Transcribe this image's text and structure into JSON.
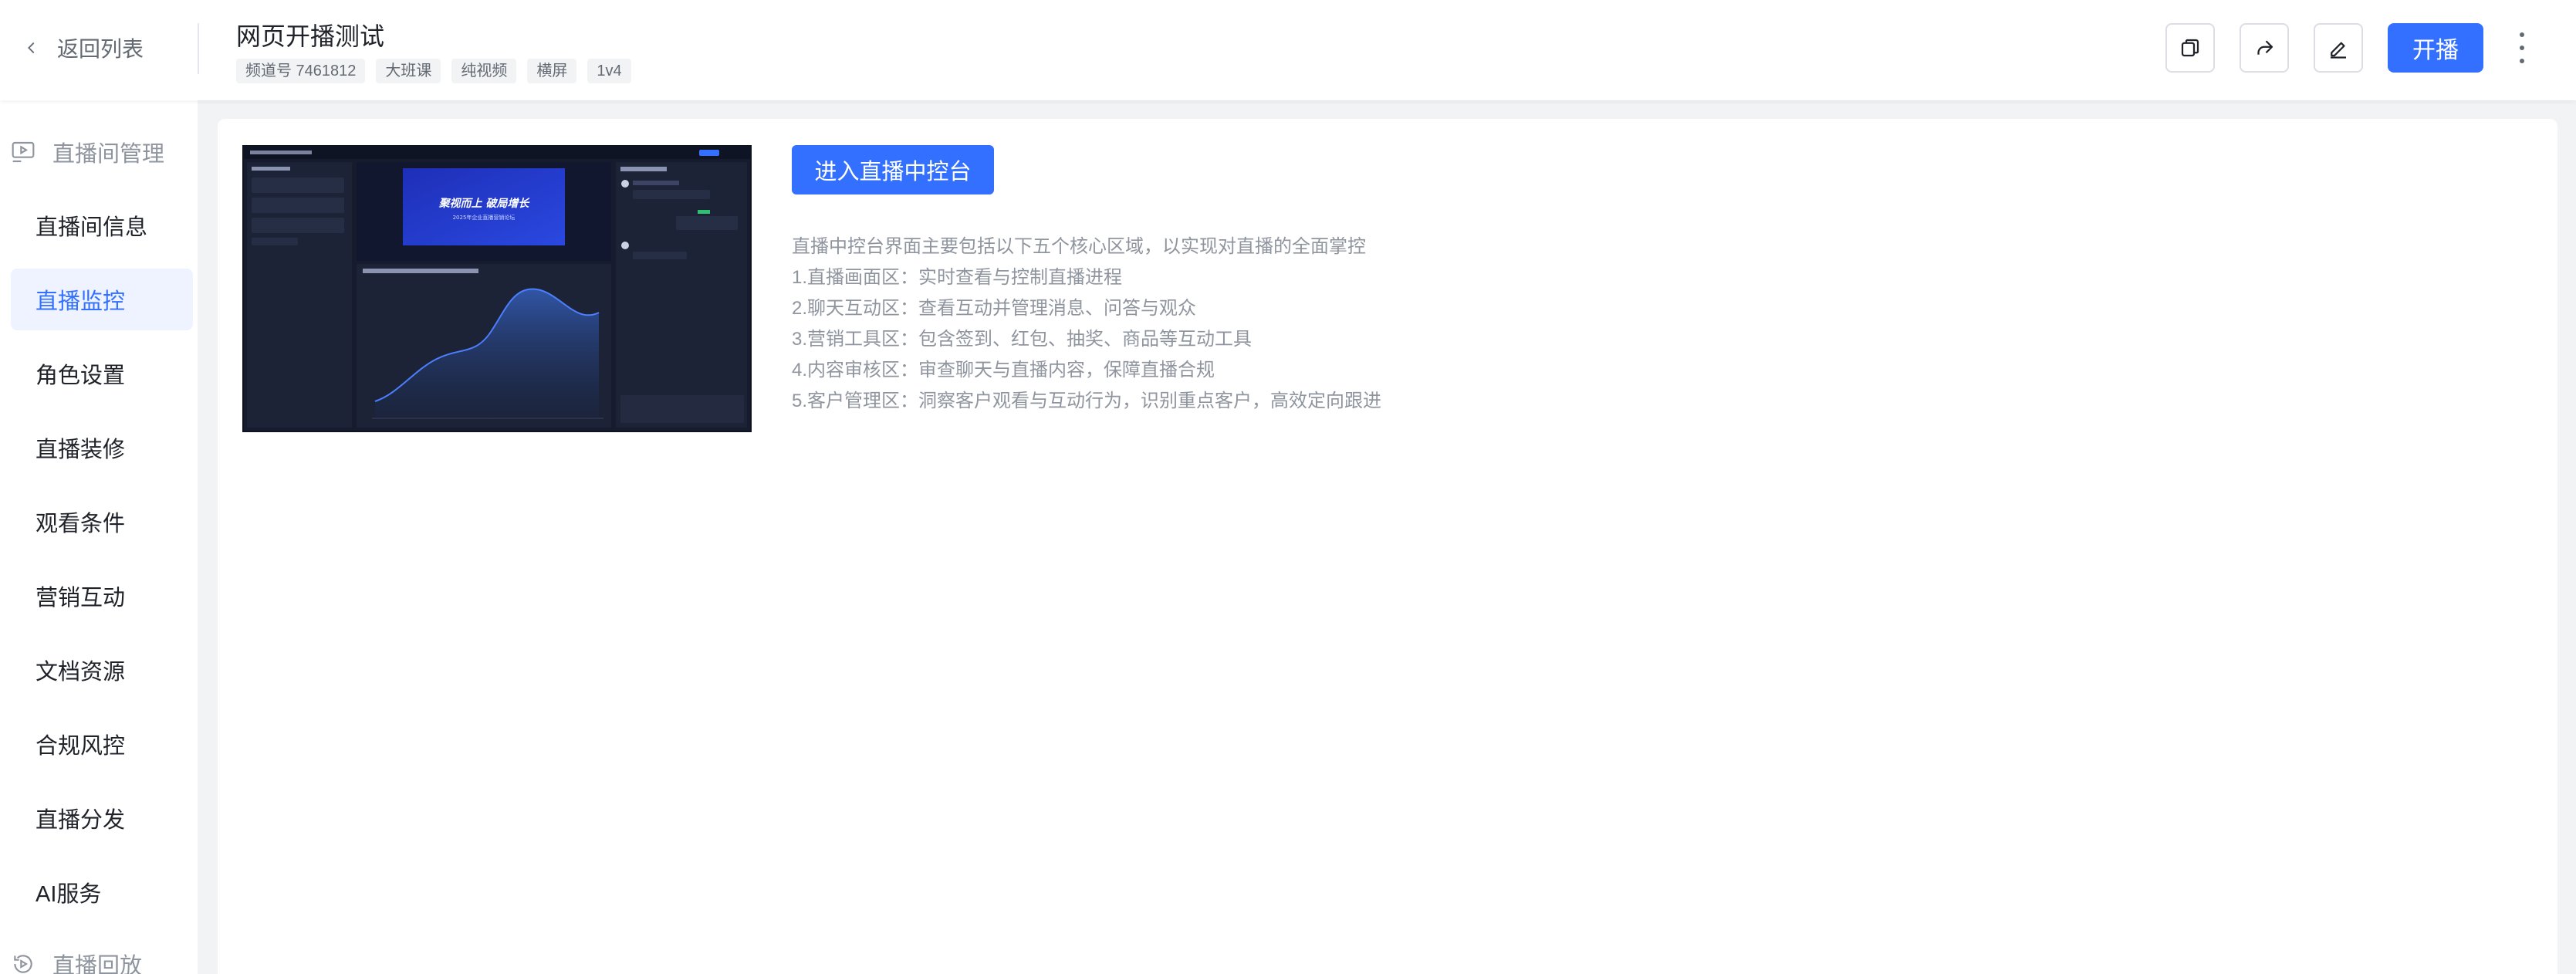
{
  "header": {
    "back_label": "返回列表",
    "title": "网页开播测试",
    "tags": [
      "频道号 7461812",
      "大班课",
      "纯视频",
      "横屏",
      "1v4"
    ],
    "actions": {
      "copy_icon": "copy-icon",
      "share_icon": "share-icon",
      "edit_icon": "edit-icon",
      "start_label": "开播",
      "more_icon": "more-vertical-icon"
    }
  },
  "sidebar": {
    "group_live_room": "直播间管理",
    "items": [
      {
        "label": "直播间信息",
        "active": false
      },
      {
        "label": "直播监控",
        "active": true
      },
      {
        "label": "角色设置",
        "active": false
      },
      {
        "label": "直播装修",
        "active": false
      },
      {
        "label": "观看条件",
        "active": false
      },
      {
        "label": "营销互动",
        "active": false
      },
      {
        "label": "文档资源",
        "active": false
      },
      {
        "label": "合规风控",
        "active": false
      },
      {
        "label": "直播分发",
        "active": false
      },
      {
        "label": "AI服务",
        "active": false
      }
    ],
    "group_replay": "直播回放"
  },
  "main": {
    "enter_button_label": "进入直播中控台",
    "description": [
      "直播中控台界面主要包括以下五个核心区域，以实现对直播的全面掌控",
      "1.直播画面区：实时查看与控制直播进程",
      "2.聊天互动区：查看互动并管理消息、问答与观众",
      "3.营销工具区：包含签到、红包、抽奖、商品等互动工具",
      "4.内容审核区：审查聊天与直播内容，保障直播合规",
      "5.客户管理区：洞察客户观看与互动行为，识别重点客户，高效定向跟进"
    ],
    "preview": {
      "banner_line1": "聚视而上 破局增长",
      "banner_line2": "2025年企业直播营销论坛"
    }
  },
  "colors": {
    "accent": "#3370ff",
    "active_bg": "#eef3ff",
    "preview_bg": "#1a2138"
  }
}
